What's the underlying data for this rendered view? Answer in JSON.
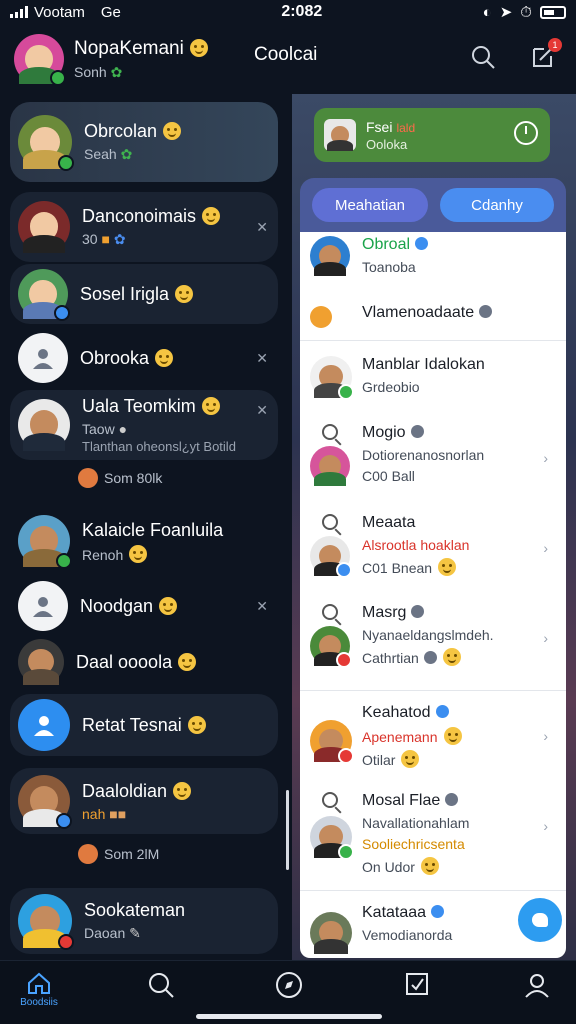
{
  "status_bar": {
    "carrier": "Vootam",
    "network": "Ge",
    "time": "2:082"
  },
  "header": {
    "user_name": "NopaKemani",
    "user_sub": "Sonh",
    "title": "Coolcai",
    "notification_count": "1"
  },
  "chats": [
    {
      "name": "Obrcolan",
      "sub": "Seah",
      "sub2": ""
    },
    {
      "name": "Danconoimais",
      "sub": "30",
      "sub2": ""
    },
    {
      "name": "Sosel Irigla",
      "sub": "",
      "sub2": ""
    },
    {
      "name": "Obrooka",
      "sub": "",
      "sub2": ""
    },
    {
      "name": "Uala Teomkim",
      "sub": "Taow",
      "sub2": "Tlanthan oheonsl¿yt Botild"
    },
    {
      "name": "Kalaicle Foanluila",
      "sub": "Renoh",
      "sub2": ""
    },
    {
      "name": "Noodgan",
      "sub": "",
      "sub2": ""
    },
    {
      "name": "Daal oooola",
      "sub": "",
      "sub2": ""
    },
    {
      "name": "Retat Tesnai",
      "sub": "",
      "sub2": ""
    },
    {
      "name": "Daaloldian",
      "sub": "nah",
      "sub2": ""
    },
    {
      "name": "Sookateman",
      "sub": "Daoan",
      "sub2": ""
    }
  ],
  "mini_lines": {
    "first": "Som 80lk",
    "second": "Som 2lM"
  },
  "status_card": {
    "name": "Fsei",
    "tag": "lald",
    "sub": "Ooloka"
  },
  "tabs": {
    "a": "Meahatian",
    "b": "Cdanhy"
  },
  "contacts": [
    {
      "name": "Obroal",
      "line1": "Toanoba",
      "line2": ""
    },
    {
      "name": "Vlamenoadaate",
      "line1": "",
      "line2": ""
    },
    {
      "name": "Manblar Idalokan",
      "line1": "Grdeobio",
      "line2": ""
    },
    {
      "name": "Mogio",
      "line1": "Dotiorenanosnorlan",
      "line2": "C00 Ball"
    },
    {
      "name": "Meaata",
      "line1": "Alsrootla hoaklan",
      "line2": "C01 Bnean"
    },
    {
      "name": "Masrg",
      "line1": "Nyanaeldangslmdeh.",
      "line2": "Cathrtian"
    },
    {
      "name": "Keahatod",
      "line1": "Apenemann",
      "line2": "Otilar"
    },
    {
      "name": "Mosal Flae",
      "line1": "Navallationahlam",
      "line2": "Sooliechricsenta",
      "line3": "On Udor"
    },
    {
      "name": "Katataaa",
      "line1": "Vemodianorda",
      "line2": ""
    }
  ],
  "bottom_nav": {
    "home_label": "Boodsiis"
  },
  "colors": {
    "accent": "#4aa3ff",
    "status_card": "#4c8a3c",
    "tab_a": "#5f6fd4",
    "tab_b": "#4a8df0"
  }
}
